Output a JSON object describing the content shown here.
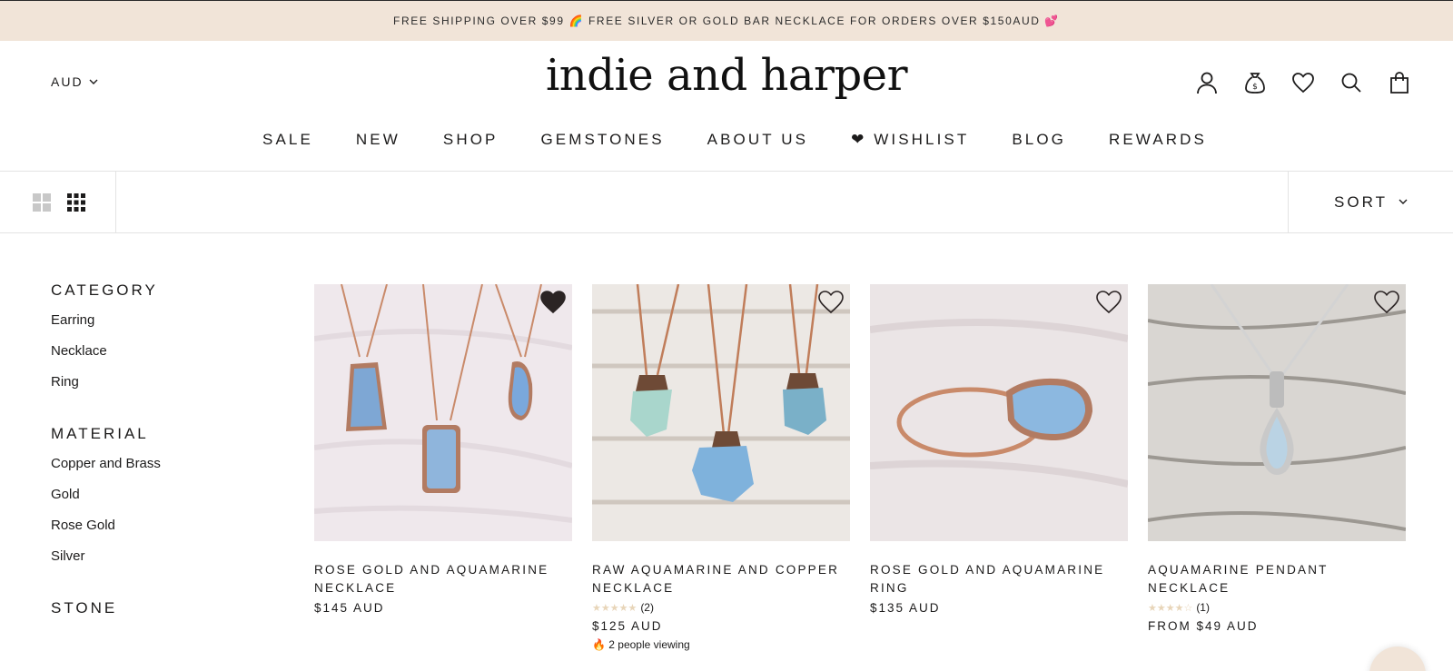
{
  "announcement": "FREE SHIPPING OVER $99 🌈 FREE SILVER OR GOLD BAR NECKLACE FOR ORDERS OVER $150AUD 💕",
  "header": {
    "currency": "AUD",
    "logo": "indie and harper",
    "icons": [
      "account-icon",
      "rewards-money-bag-icon",
      "wishlist-heart-icon",
      "search-icon",
      "cart-bag-icon"
    ]
  },
  "nav": {
    "items": [
      "SALE",
      "NEW",
      "SHOP",
      "GEMSTONES",
      "ABOUT US",
      "❤ WISHLIST",
      "BLOG",
      "REWARDS"
    ]
  },
  "toolbar": {
    "sort_label": "SORT",
    "views": [
      "grid-2-icon",
      "grid-3-icon"
    ]
  },
  "filters": {
    "category": {
      "title": "CATEGORY",
      "items": [
        "Earring",
        "Necklace",
        "Ring"
      ]
    },
    "material": {
      "title": "MATERIAL",
      "items": [
        "Copper and Brass",
        "Gold",
        "Rose Gold",
        "Silver"
      ]
    },
    "stone": {
      "title": "STONE"
    }
  },
  "products": [
    {
      "title": "ROSE GOLD AND AQUAMARINE NECKLACE",
      "price": "$145 AUD",
      "rating": "",
      "rating_count": "",
      "viewing": "",
      "wishlisted": true
    },
    {
      "title": "RAW AQUAMARINE AND COPPER NECKLACE",
      "price": "$125 AUD",
      "rating": "★★★★★",
      "rating_count": "(2)",
      "viewing": "🔥 2 people viewing",
      "wishlisted": false
    },
    {
      "title": "ROSE GOLD AND AQUAMARINE RING",
      "price": "$135 AUD",
      "rating": "",
      "rating_count": "",
      "viewing": "",
      "wishlisted": false
    },
    {
      "title": "AQUAMARINE PENDANT NECKLACE",
      "price": "FROM $49 AUD",
      "rating": "★★★★☆",
      "rating_count": "(1)",
      "viewing": "",
      "wishlisted": false
    }
  ],
  "colors": {
    "announcement_bg": "#f1e4d8",
    "text": "#1c1b1b",
    "star": "#e8d5b9"
  }
}
